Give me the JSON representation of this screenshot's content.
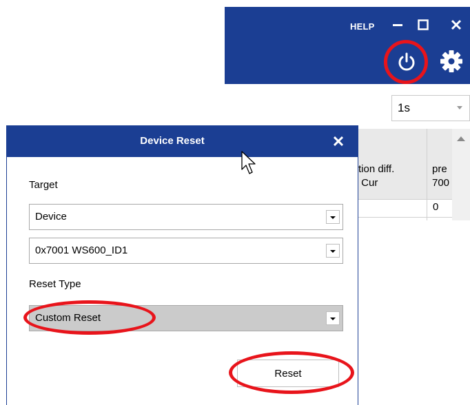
{
  "app": {
    "help_label": "HELP",
    "interval_value": "1s",
    "table": {
      "col1_header": "tion diff.\n Cur",
      "col2_header": "pre\n700",
      "cell_value": "0"
    },
    "icons": [
      "minimize-icon",
      "maximize-icon",
      "close-icon",
      "power-icon",
      "gear-icon"
    ]
  },
  "dialog": {
    "title": "Device Reset",
    "target_label": "Target",
    "target_value": "Device",
    "device_value": "0x7001 WS600_ID1",
    "reset_type_label": "Reset Type",
    "reset_type_value": "Custom Reset",
    "reset_button": "Reset"
  },
  "colors": {
    "header_blue": "#1b3e93",
    "highlight_red": "#e8141b",
    "selected_gray": "#cbcbcb"
  }
}
